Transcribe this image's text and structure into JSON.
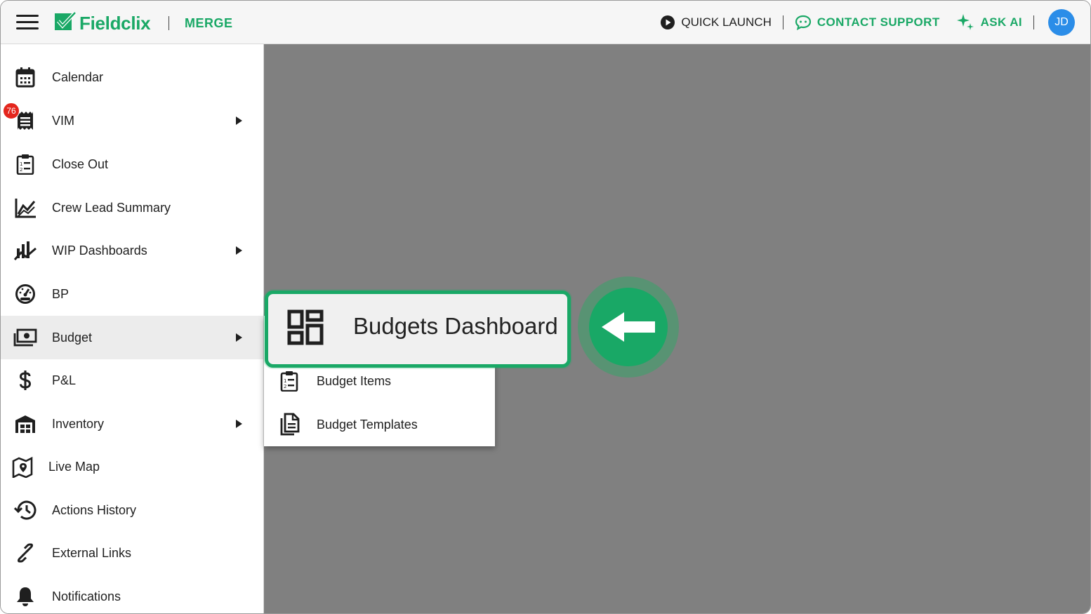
{
  "app": {
    "brand": "Fieldclix",
    "company": "MERGE"
  },
  "topbar": {
    "quick_launch": "QUICK LAUNCH",
    "contact_support": "CONTACT SUPPORT",
    "ask_ai": "ASK AI",
    "avatar_initials": "JD"
  },
  "sidebar": {
    "vim_badge": "76",
    "items": [
      {
        "label": "Calendar",
        "icon": "calendar-icon",
        "has_submenu": false
      },
      {
        "label": "VIM",
        "icon": "receipt-icon",
        "has_submenu": true
      },
      {
        "label": "Close Out",
        "icon": "clipboard-list-icon",
        "has_submenu": false
      },
      {
        "label": "Crew Lead Summary",
        "icon": "line-chart-icon",
        "has_submenu": false
      },
      {
        "label": "WIP Dashboards",
        "icon": "bar-chart-trend-icon",
        "has_submenu": true
      },
      {
        "label": "BP",
        "icon": "gauge-icon",
        "has_submenu": false
      },
      {
        "label": "Budget",
        "icon": "money-icon",
        "has_submenu": true,
        "active": true
      },
      {
        "label": "P&L",
        "icon": "dollar-icon",
        "has_submenu": false
      },
      {
        "label": "Inventory",
        "icon": "warehouse-icon",
        "has_submenu": true
      },
      {
        "label": "Live Map",
        "icon": "map-icon",
        "has_submenu": false
      },
      {
        "label": "Actions History",
        "icon": "history-icon",
        "has_submenu": false
      },
      {
        "label": "External Links",
        "icon": "link-icon",
        "has_submenu": false
      },
      {
        "label": "Notifications",
        "icon": "bell-icon",
        "has_submenu": false
      }
    ]
  },
  "submenu": {
    "items": [
      {
        "label": "Budgets Dashboard",
        "icon": "dashboard-icon"
      },
      {
        "label": "Budget Items",
        "icon": "clipboard-list-icon"
      },
      {
        "label": "Budget Templates",
        "icon": "documents-icon"
      }
    ]
  },
  "colors": {
    "brand_green": "#1aa866",
    "avatar_blue": "#2b8de8",
    "badge_red": "#e4261d",
    "overlay": "#808080"
  }
}
